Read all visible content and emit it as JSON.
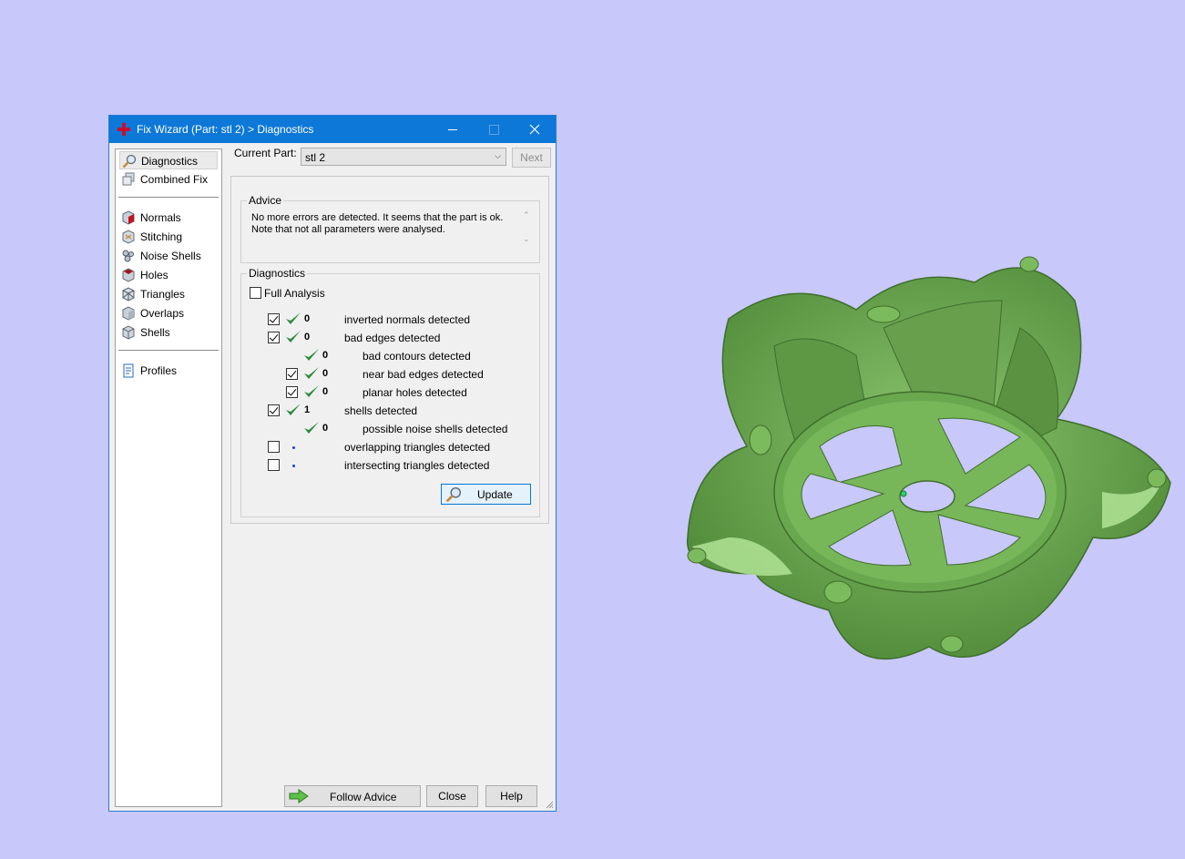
{
  "window": {
    "title": "Fix Wizard (Part: stl 2) > Diagnostics"
  },
  "nav": {
    "group1": [
      {
        "label": "Diagnostics",
        "icon": "magnifier-icon",
        "selected": true
      },
      {
        "label": "Combined Fix",
        "icon": "combined-fix-icon"
      }
    ],
    "group2": [
      {
        "label": "Normals",
        "icon": "normals-icon"
      },
      {
        "label": "Stitching",
        "icon": "stitching-icon"
      },
      {
        "label": "Noise Shells",
        "icon": "noise-shells-icon"
      },
      {
        "label": "Holes",
        "icon": "holes-icon"
      },
      {
        "label": "Triangles",
        "icon": "triangles-icon"
      },
      {
        "label": "Overlaps",
        "icon": "overlaps-icon"
      },
      {
        "label": "Shells",
        "icon": "shells-icon"
      }
    ],
    "group3": [
      {
        "label": "Profiles",
        "icon": "profiles-icon"
      }
    ]
  },
  "current_part": {
    "label": "Current Part:",
    "value": "stl 2",
    "next_label": "Next"
  },
  "advice": {
    "title": "Advice",
    "line1": "No more errors are detected. It seems that the part is ok.",
    "line2": "Note that not all parameters were analysed."
  },
  "diagnostics": {
    "title": "Diagnostics",
    "full_analysis_label": "Full Analysis",
    "rows": [
      {
        "checked": true,
        "status": "ok",
        "count": "0",
        "label": "inverted normals detected"
      },
      {
        "checked": true,
        "status": "ok",
        "count": "0",
        "label": "bad edges detected"
      },
      {
        "checked": null,
        "status": "ok",
        "count": "0",
        "label": "bad contours detected"
      },
      {
        "checked": true,
        "status": "ok",
        "count": "0",
        "label": "near bad edges detected"
      },
      {
        "checked": true,
        "status": "ok",
        "count": "0",
        "label": "planar holes detected"
      },
      {
        "checked": true,
        "status": "ok",
        "count": "1",
        "label": "shells detected"
      },
      {
        "checked": null,
        "status": "ok",
        "count": "0",
        "label": "possible noise shells detected"
      },
      {
        "checked": false,
        "status": "pending",
        "count": "",
        "label": "overlapping triangles detected"
      },
      {
        "checked": false,
        "status": "pending",
        "count": "",
        "label": "intersecting triangles detected"
      }
    ],
    "update_label": "Update"
  },
  "footer": {
    "follow_advice_label": "Follow Advice",
    "close_label": "Close",
    "help_label": "Help"
  },
  "colors": {
    "desktop": "#c8c8fa",
    "titlebar": "#0d78d7",
    "tick": "#2f8a3c",
    "model_green": "#6aa84f"
  }
}
